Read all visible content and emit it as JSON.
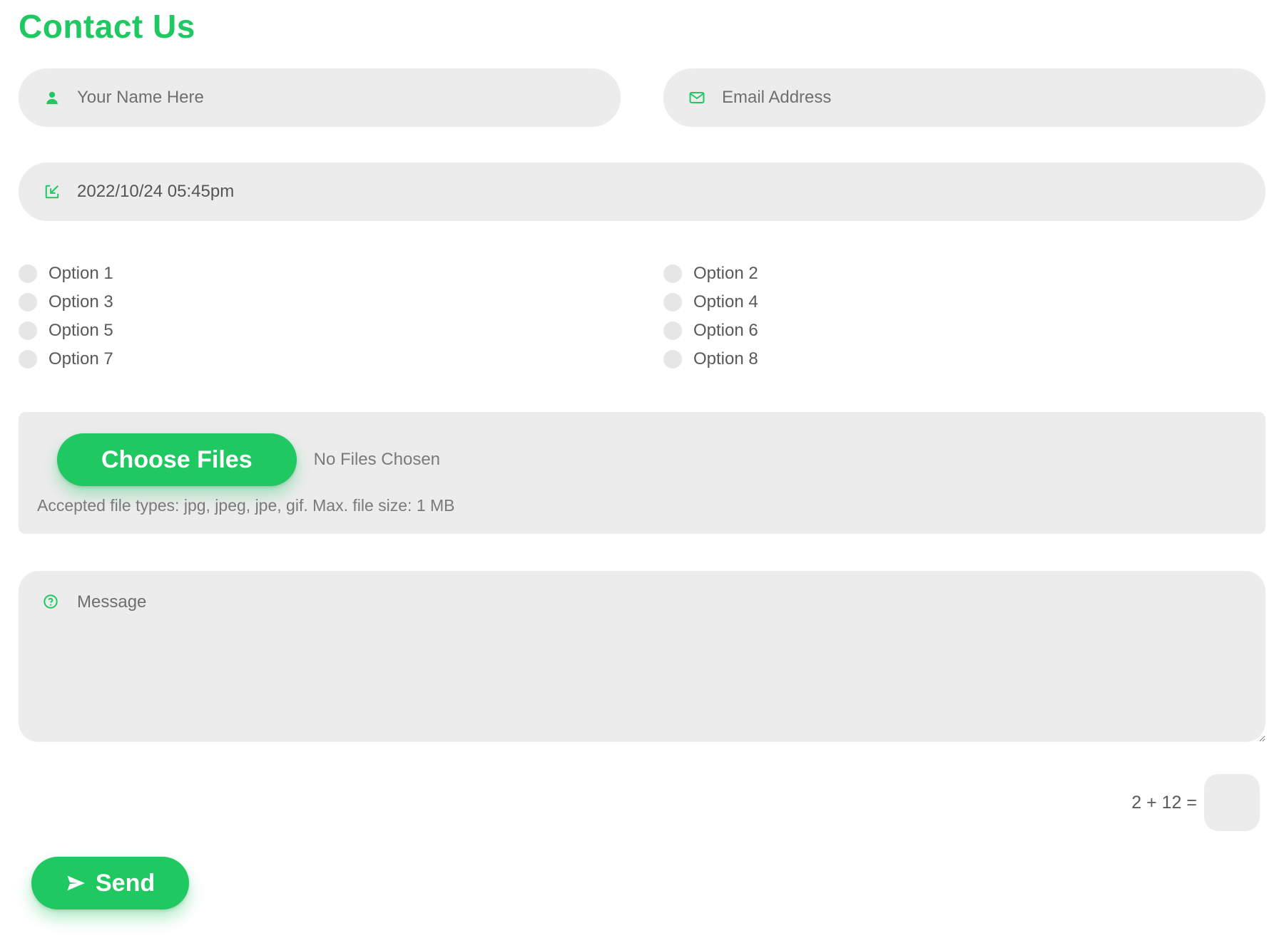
{
  "title": "Contact Us",
  "name": {
    "placeholder": "Your Name Here",
    "value": ""
  },
  "email": {
    "placeholder": "Email Address",
    "value": ""
  },
  "datetime": {
    "value": "2022/10/24 05:45pm"
  },
  "checkboxes": [
    {
      "label": "Option 1",
      "checked": false
    },
    {
      "label": "Option 2",
      "checked": false
    },
    {
      "label": "Option 3",
      "checked": false
    },
    {
      "label": "Option 4",
      "checked": false
    },
    {
      "label": "Option 5",
      "checked": false
    },
    {
      "label": "Option 6",
      "checked": false
    },
    {
      "label": "Option 7",
      "checked": false
    },
    {
      "label": "Option 8",
      "checked": false
    }
  ],
  "file": {
    "choose_label": "Choose Files",
    "status": "No Files Chosen",
    "hint": "Accepted file types: jpg, jpeg, jpe, gif. Max. file size: 1 MB"
  },
  "message": {
    "placeholder": "Message",
    "value": ""
  },
  "captcha": {
    "question": "2 + 12 =",
    "value": ""
  },
  "send_label": "Send",
  "colors": {
    "accent": "#1fc861",
    "field_bg": "#ececec"
  }
}
